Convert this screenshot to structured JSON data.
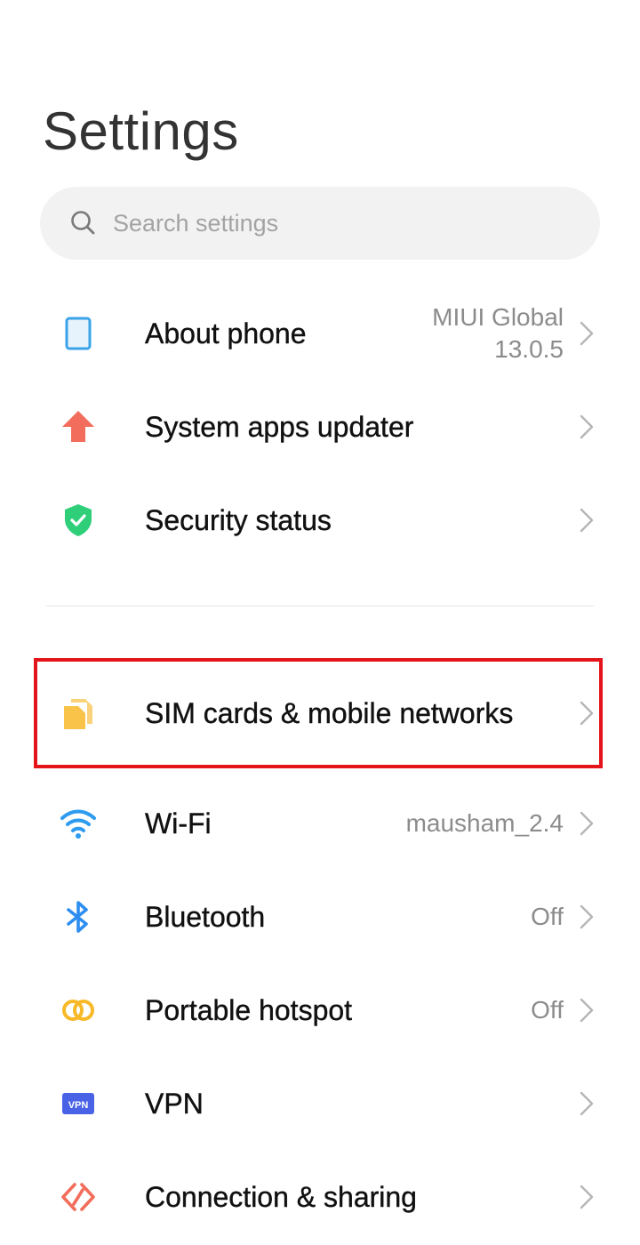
{
  "header": {
    "title": "Settings"
  },
  "search": {
    "placeholder": "Search settings"
  },
  "items": [
    {
      "label": "About phone",
      "value": "MIUI Global 13.0.5",
      "icon": "phone-icon"
    },
    {
      "label": "System apps updater",
      "value": "",
      "icon": "arrow-up-icon"
    },
    {
      "label": "Security status",
      "value": "",
      "icon": "shield-check-icon"
    },
    {
      "label": "SIM cards & mobile networks",
      "value": "",
      "icon": "sim-card-icon"
    },
    {
      "label": "Wi-Fi",
      "value": "mausham_2.4",
      "icon": "wifi-icon"
    },
    {
      "label": "Bluetooth",
      "value": "Off",
      "icon": "bluetooth-icon"
    },
    {
      "label": "Portable hotspot",
      "value": "Off",
      "icon": "hotspot-icon"
    },
    {
      "label": "VPN",
      "value": "",
      "icon": "vpn-icon"
    },
    {
      "label": "Connection & sharing",
      "value": "",
      "icon": "connection-sharing-icon"
    }
  ],
  "about_value_lines": [
    "MIUI Global",
    "13.0.5"
  ],
  "colors": {
    "phone_icon": "#3aa3e8",
    "updater_icon": "#f26d5b",
    "security_icon": "#2fcf7a",
    "sim_icon": "#f9c34a",
    "wifi_icon": "#2d9bf0",
    "bluetooth_icon": "#2d8ef0",
    "hotspot_icon": "#f7b928",
    "vpn_icon": "#4a63e6",
    "connection_icon": "#f26d5b",
    "highlight_border": "#e4141b"
  }
}
